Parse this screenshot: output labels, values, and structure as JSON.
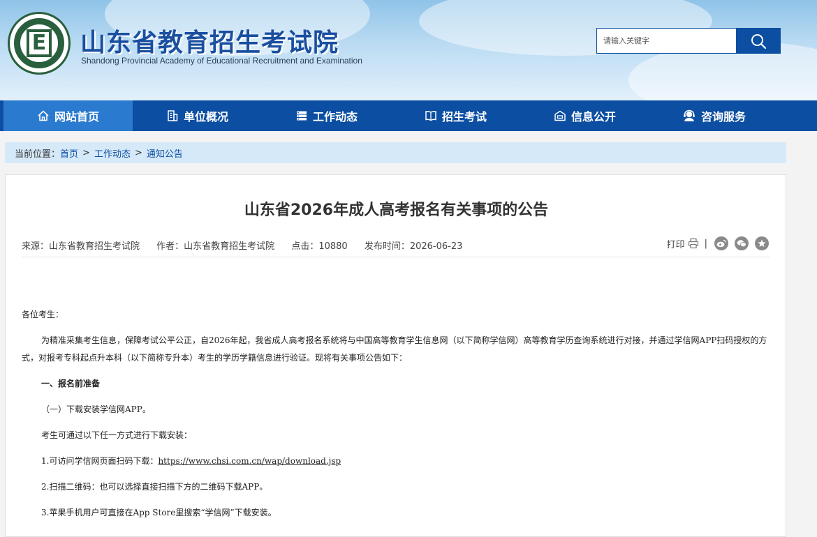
{
  "header": {
    "logo_letter": "E",
    "title": "山东省教育招生考试院",
    "subtitle": "Shandong Provincial Academy of Educational Recruitment and Examination",
    "search_placeholder": "请输入关键字"
  },
  "nav": {
    "items": [
      {
        "label": "网站首页",
        "icon": "home-icon"
      },
      {
        "label": "单位概况",
        "icon": "building-icon"
      },
      {
        "label": "工作动态",
        "icon": "news-icon"
      },
      {
        "label": "招生考试",
        "icon": "book-icon"
      },
      {
        "label": "信息公开",
        "icon": "info-icon"
      },
      {
        "label": "咨询服务",
        "icon": "headset-icon"
      }
    ]
  },
  "breadcrumb": {
    "prefix": "当前位置：",
    "items": [
      "首页",
      "工作动态",
      "通知公告"
    ],
    "separator": ">"
  },
  "article": {
    "title": "山东省2026年成人高考报名有关事项的公告",
    "meta": {
      "source": "来源：山东省教育招生考试院",
      "author": "作者：山东省教育招生考试院",
      "clicks": "点击：10880",
      "date": "发布时间：2026-06-23"
    },
    "tools": {
      "print_label": "打印",
      "separator": "|"
    },
    "greeting": "各位考生：",
    "intro": "为精准采集考生信息，保障考试公平公正，自2026年起，我省成人高考报名系统将与中国高等教育学生信息网（以下简称学信网）高等教育学历查询系统进行对接，并通过学信网APP扫码授权的方式，对报考专科起点升本科（以下简称专升本）考生的学历学籍信息进行验证。现将有关事项公告如下：",
    "section1": "一、报名前准备",
    "sub1": "（一）下载安装学信网APP。",
    "p1": "考生可通过以下任一方式进行下载安装：",
    "item1_prefix": "1.可访问学信网页面扫码下载：",
    "item1_link": "https://www.chsi.com.cn/wap/download.jsp",
    "item2": "2.扫描二维码：也可以选择直接扫描下方的二维码下载APP。",
    "item3": "3.苹果手机用户可直接在App Store里搜索“学信网”下载安装。"
  },
  "colors": {
    "nav_bg": "#0b4ea2",
    "nav_active": "#2a7bd0",
    "crumb_bg": "#d6e9f8",
    "title_blue": "#1a4fa0"
  }
}
